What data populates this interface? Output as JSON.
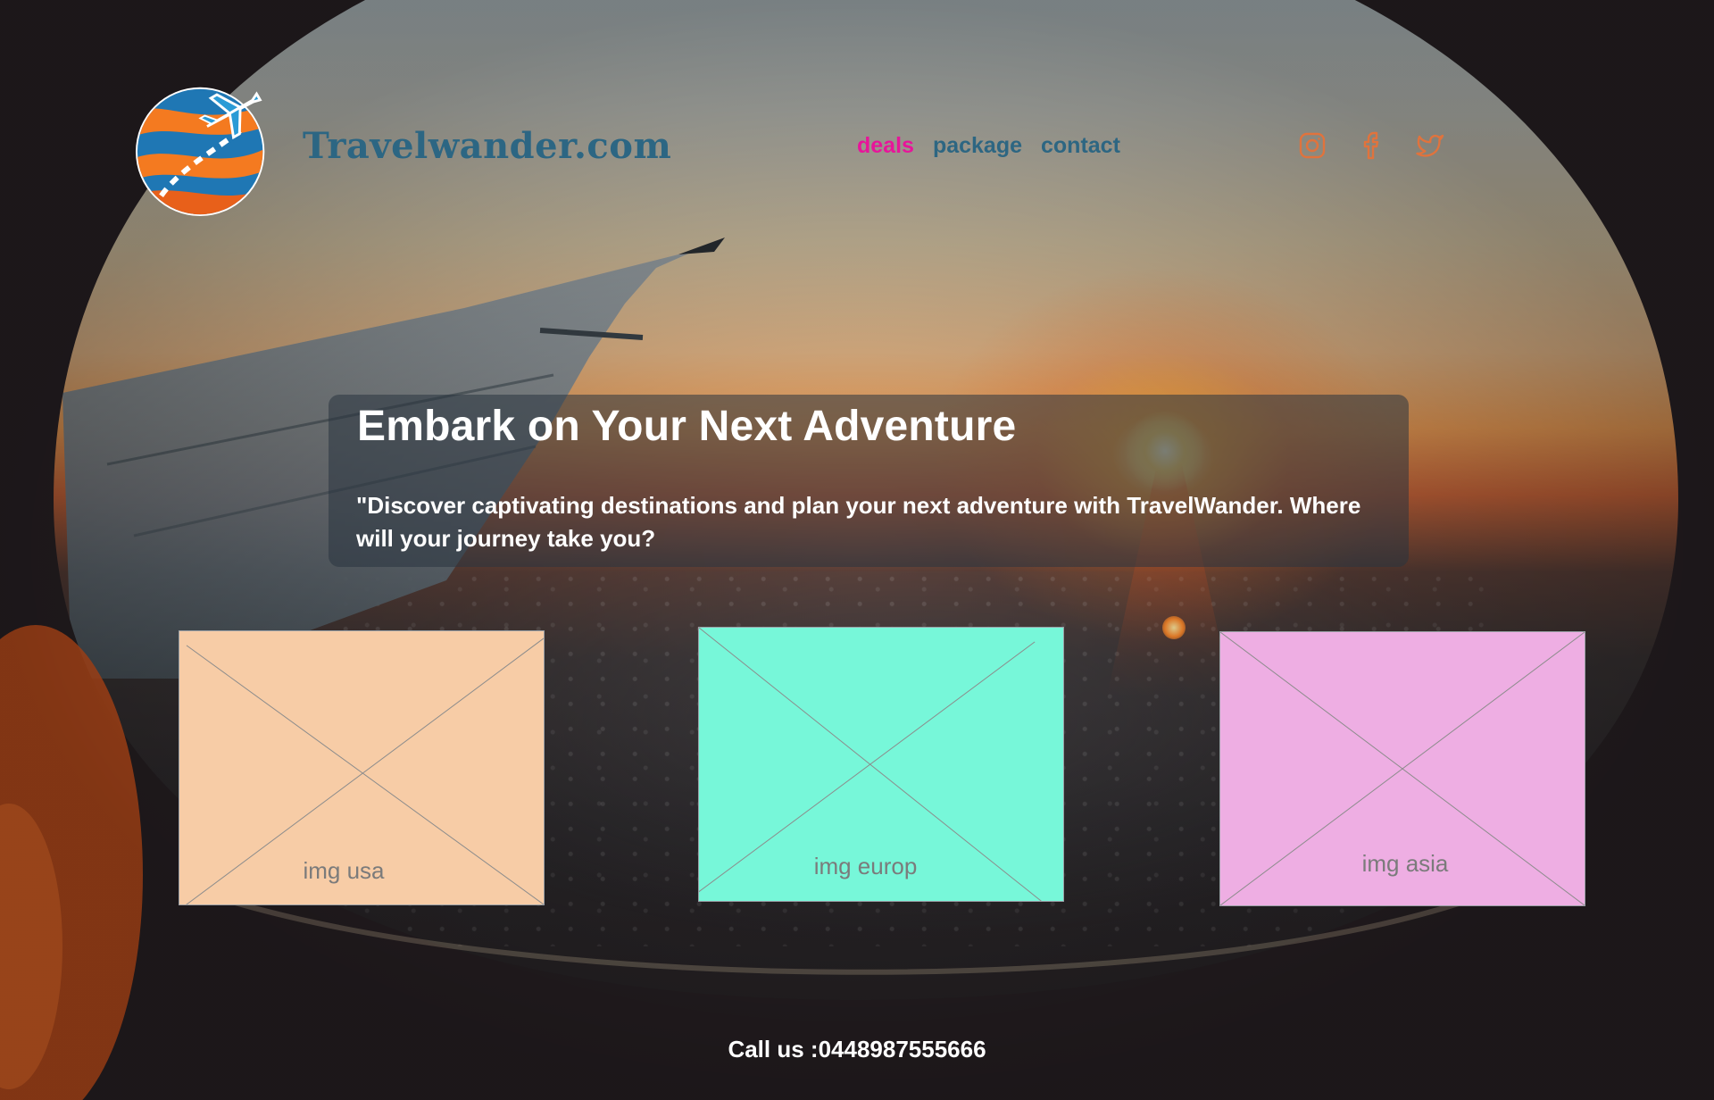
{
  "brand": {
    "name": "Travelwander.com"
  },
  "nav": {
    "items": [
      {
        "label": "deals",
        "active": true
      },
      {
        "label": "package",
        "active": false
      },
      {
        "label": "contact",
        "active": false
      }
    ]
  },
  "social": {
    "icons": [
      "instagram-icon",
      "facebook-icon",
      "twitter-icon"
    ],
    "color": "#e0733d"
  },
  "hero": {
    "title": "Embark on Your Next Adventure",
    "text": "\"Discover captivating destinations and plan your next adventure with TravelWander. Where will your journey take you?"
  },
  "cards": [
    {
      "label": "img usa",
      "color": "#f7cca6"
    },
    {
      "label": "img europ",
      "color": "#77f7d9"
    },
    {
      "label": "img asia",
      "color": "#eeaee3"
    }
  ],
  "footer": {
    "call": "Call us :0448987555666"
  },
  "colors": {
    "brand": "#2c6683",
    "nav_active": "#e7159a",
    "nav": "#2d6682"
  }
}
